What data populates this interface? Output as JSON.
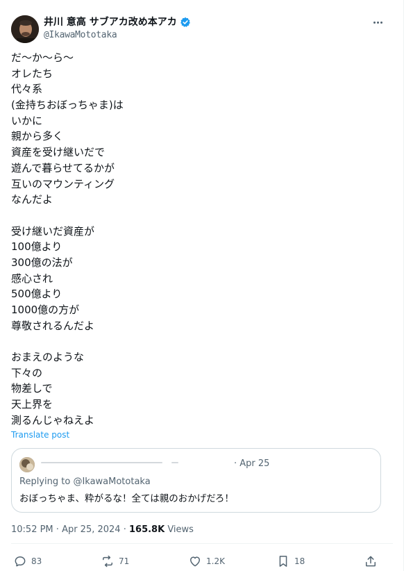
{
  "author": {
    "display_name": "井川 意高 サブアカ改め本アカ",
    "handle": "@IkawaMototaka"
  },
  "tweet": {
    "lines": [
      "だ〜か〜ら〜",
      "オレたち",
      "代々系",
      "(金持ちおぼっちゃま)は",
      "いかに",
      "親から多く",
      "資産を受け継いだで",
      "遊んで暮らせてるかが",
      "互いのマウンティング",
      "なんだよ",
      "",
      "受け継いだ資産が",
      "100億より",
      "300億の法が",
      "感心され",
      "500億より",
      "1000億の方が",
      "尊敬されるんだよ",
      "",
      "おまえのような",
      "下々の",
      "物差しで",
      "天上界を",
      "測るんじゃねえよ"
    ],
    "translate_label": "Translate post"
  },
  "quote": {
    "date": "· Apr 25",
    "replying_prefix": "Replying to ",
    "replying_handle": "@IkawaMototaka",
    "body": "おぼっちゃま、粋がるな！全ては親のおかげだろ！"
  },
  "meta": {
    "time": "10:52 PM",
    "separator": " · ",
    "date": "Apr 25, 2024",
    "views_count": "165.8K",
    "views_label": " Views"
  },
  "actions": {
    "replies": "83",
    "reposts": "71",
    "likes": "1.2K",
    "bookmarks": "18"
  },
  "colors": {
    "accent": "#1d9bf0",
    "text": "#0f1419",
    "muted": "#536471",
    "border": "#cfd9de"
  }
}
